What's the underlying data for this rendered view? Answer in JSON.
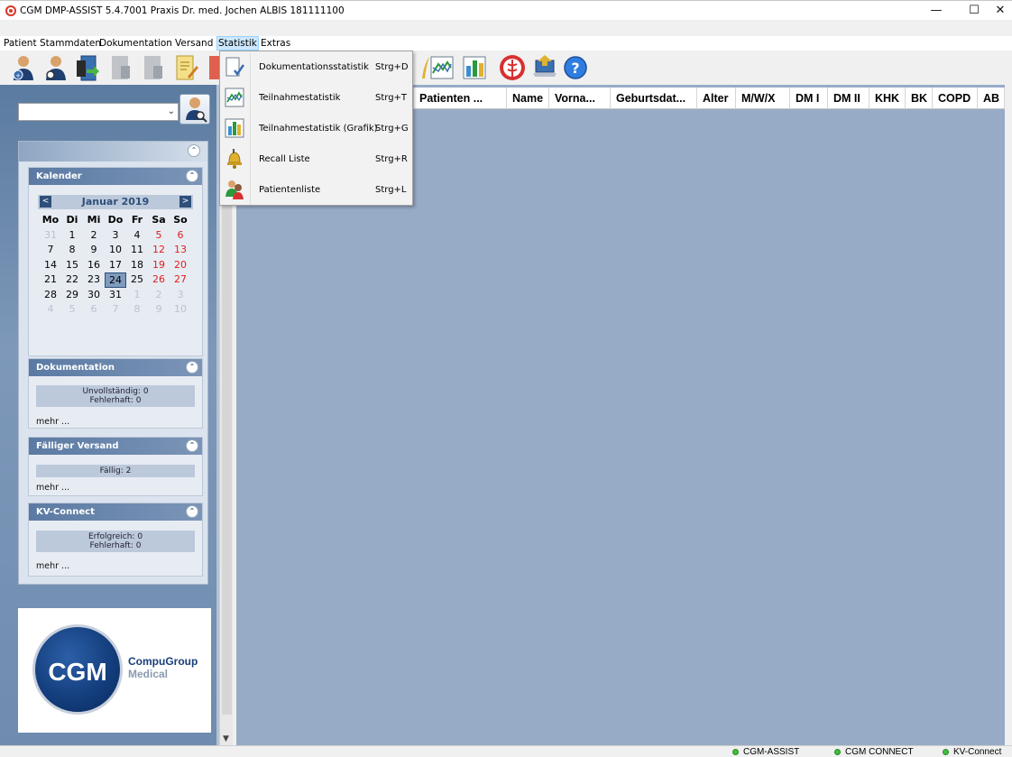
{
  "window": {
    "title": "CGM DMP-ASSIST 5.4.7001 Praxis Dr. med. Jochen ALBIS 181111100",
    "minimize": "—",
    "maximize": "☐",
    "close": "✕"
  },
  "menubar": {
    "items": [
      "Patient",
      "Stammdaten",
      "Dokumentation",
      "Versand",
      "Statistik",
      "Extras"
    ],
    "active": "Statistik"
  },
  "statistik_menu": {
    "items": [
      {
        "label": "Dokumentationsstatistik",
        "shortcut": "Strg+D",
        "icon": "document-stats-icon"
      },
      {
        "label": "Teilnahmestatistik",
        "shortcut": "Strg+T",
        "icon": "line-chart-icon"
      },
      {
        "label": "Teilnahmestatistik (Grafik)",
        "shortcut": "Strg+G",
        "icon": "bar-chart-icon"
      },
      {
        "label": "Recall Liste",
        "shortcut": "Strg+R",
        "icon": "bell-icon"
      },
      {
        "label": "Patientenliste",
        "shortcut": "Strg+L",
        "icon": "patients-icon"
      }
    ]
  },
  "grid": {
    "columns": [
      "...",
      "Patienten ...",
      "Name",
      "Vorna...",
      "Geburtsdat...",
      "Alter",
      "M/W/X",
      "DM I",
      "DM II",
      "KHK",
      "BK",
      "COPD",
      "AB"
    ]
  },
  "sidebar": {
    "calendar": {
      "title": "Kalender",
      "month": "Januar 2019",
      "prev": "<",
      "next": ">",
      "weekdays": [
        "Mo",
        "Di",
        "Mi",
        "Do",
        "Fr",
        "Sa",
        "So"
      ],
      "weeks": [
        [
          "31",
          "1",
          "2",
          "3",
          "4",
          "5",
          "6"
        ],
        [
          "7",
          "8",
          "9",
          "10",
          "11",
          "12",
          "13"
        ],
        [
          "14",
          "15",
          "16",
          "17",
          "18",
          "19",
          "20"
        ],
        [
          "21",
          "22",
          "23",
          "24",
          "25",
          "26",
          "27"
        ],
        [
          "28",
          "29",
          "30",
          "31",
          "1",
          "2",
          "3"
        ],
        [
          "4",
          "5",
          "6",
          "7",
          "8",
          "9",
          "10"
        ]
      ],
      "today": "24"
    },
    "dokumentation": {
      "title": "Dokumentation",
      "line1": "Unvollständig: 0",
      "line2": "Fehlerhaft: 0",
      "more": "mehr ..."
    },
    "versand": {
      "title": "Fälliger Versand",
      "line1": "Fällig: 2",
      "more": "mehr ..."
    },
    "kvconnect": {
      "title": "KV-Connect",
      "line1": "Erfolgreich: 0",
      "line2": "Fehlerhaft: 0",
      "more": "mehr ..."
    },
    "logo": {
      "mark": "CGM",
      "line1": "CompuGroup",
      "line2": "Medical"
    }
  },
  "statusbar": {
    "items": [
      "CGM-ASSIST",
      "CGM CONNECT",
      "KV-Connect"
    ]
  },
  "colors": {
    "main_bg": "#97abc7",
    "accent": "#2f4f7a",
    "weekend": "#e31c1c",
    "status_ok": "#3fbf3f"
  }
}
